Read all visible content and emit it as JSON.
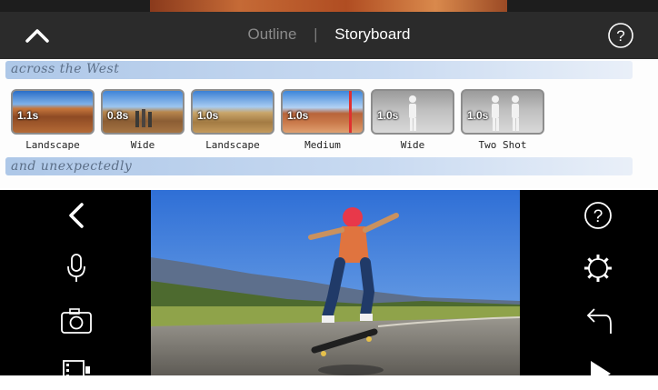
{
  "header": {
    "tabs": [
      {
        "label": "Outline",
        "selected": false
      },
      {
        "label": "Storyboard",
        "selected": true
      }
    ],
    "separator": "|",
    "left_icon": "chevron-up-icon",
    "right_icon": "help-icon"
  },
  "storyboard": {
    "captions": [
      "across the West",
      "and unexpectedly"
    ],
    "clips": [
      {
        "duration": "1.1s",
        "shot": "Landscape"
      },
      {
        "duration": "0.8s",
        "shot": "Wide"
      },
      {
        "duration": "1.0s",
        "shot": "Landscape"
      },
      {
        "duration": "1.0s",
        "shot": "Medium"
      },
      {
        "duration": "1.0s",
        "shot": "Wide"
      },
      {
        "duration": "1.0s",
        "shot": "Two Shot"
      }
    ]
  },
  "editor": {
    "left_tools": [
      "back-chevron-icon",
      "microphone-icon",
      "camera-icon",
      "film-icon"
    ],
    "right_tools": [
      "help-icon",
      "settings-gear-icon",
      "undo-icon",
      "play-icon"
    ]
  },
  "colors": {
    "toolbar": "#2b2b2b",
    "playhead": "#e0302f",
    "caption_stroke": "#a0bee4"
  }
}
